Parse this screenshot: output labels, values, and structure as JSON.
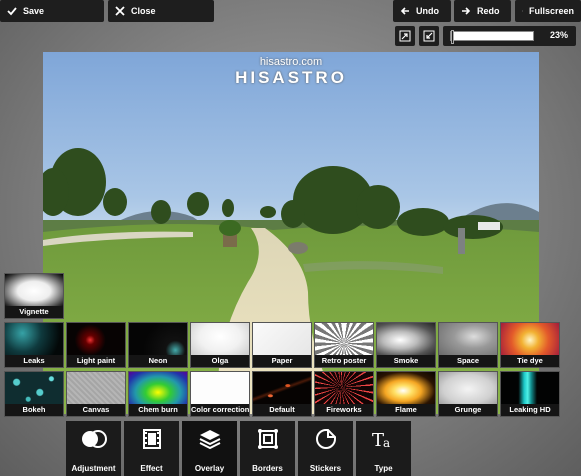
{
  "toolbar": {
    "save_label": "Save",
    "close_label": "Close",
    "undo_label": "Undo",
    "redo_label": "Redo",
    "fullscreen_label": "Fullscreen"
  },
  "zoom": {
    "value_label": "23%",
    "level": 0.23
  },
  "watermark": {
    "line1": "hisastro.com",
    "line2": "HISASTRO"
  },
  "vignette_label": "Vignette",
  "overlay_rows": [
    [
      "Leaks",
      "Light paint",
      "Neon",
      "Olga",
      "Paper",
      "Retro poster",
      "Smoke",
      "Space",
      "Tie dye"
    ],
    [
      "Bokeh",
      "Canvas",
      "Chem burn",
      "Color correction",
      "Default",
      "Fireworks",
      "Flame",
      "Grunge",
      "Leaking HD"
    ]
  ],
  "tools": [
    "Adjustment",
    "Effect",
    "Overlay",
    "Borders",
    "Stickers",
    "Type"
  ],
  "active_tool": "Overlay",
  "icons": [
    "check-icon",
    "close-icon",
    "undo-arrow-icon",
    "redo-arrow-icon",
    "fullscreen-icon",
    "fit-icon",
    "actual-size-icon"
  ]
}
